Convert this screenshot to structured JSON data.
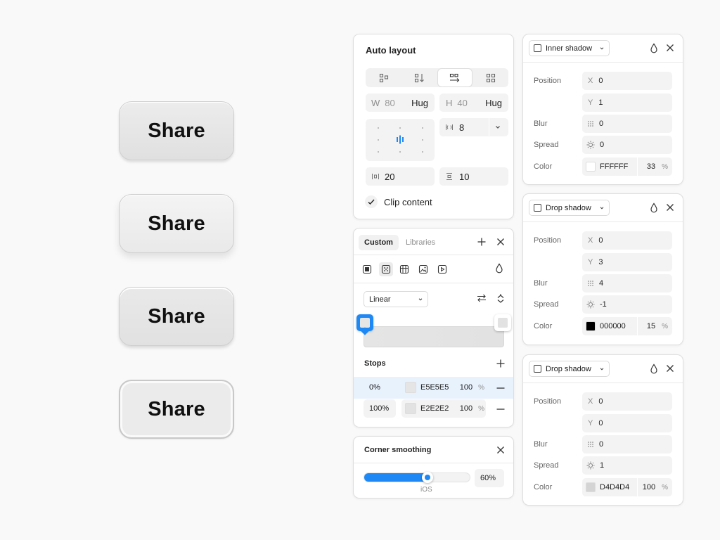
{
  "buttons": [
    {
      "label": "Share"
    },
    {
      "label": "Share"
    },
    {
      "label": "Share"
    },
    {
      "label": "Share"
    }
  ],
  "auto_layout": {
    "title": "Auto layout",
    "width_label": "W",
    "width_value": "80",
    "width_mode": "Hug",
    "height_label": "H",
    "height_value": "40",
    "height_mode": "Hug",
    "gap_value": "8",
    "padding_h": "20",
    "padding_v": "10",
    "clip_label": "Clip content"
  },
  "fill": {
    "tab_custom": "Custom",
    "tab_libraries": "Libraries",
    "gradient_type": "Linear",
    "stops_title": "Stops",
    "stops": [
      {
        "position": "0%",
        "hex": "E5E5E5",
        "opacity": "100",
        "unit": "%",
        "swatch": "#e5e5e5"
      },
      {
        "position": "100%",
        "hex": "E2E2E2",
        "opacity": "100",
        "unit": "%",
        "swatch": "#e2e2e2"
      }
    ],
    "accent": "#1e88f5"
  },
  "corner": {
    "title": "Corner smoothing",
    "value": "60%",
    "fraction": 0.6,
    "caption": "iOS"
  },
  "effects": [
    {
      "type": "Inner shadow",
      "position_label": "Position",
      "x_label": "X",
      "x": "0",
      "y_label": "Y",
      "y": "1",
      "blur_label": "Blur",
      "blur": "0",
      "spread_label": "Spread",
      "spread": "0",
      "color_label": "Color",
      "hex": "FFFFFF",
      "opacity": "33",
      "unit": "%",
      "swatch": "#ffffff"
    },
    {
      "type": "Drop shadow",
      "position_label": "Position",
      "x_label": "X",
      "x": "0",
      "y_label": "Y",
      "y": "3",
      "blur_label": "Blur",
      "blur": "4",
      "spread_label": "Spread",
      "spread": "-1",
      "color_label": "Color",
      "hex": "000000",
      "opacity": "15",
      "unit": "%",
      "swatch": "#000000"
    },
    {
      "type": "Drop shadow",
      "position_label": "Position",
      "x_label": "X",
      "x": "0",
      "y_label": "Y",
      "y": "0",
      "blur_label": "Blur",
      "blur": "0",
      "spread_label": "Spread",
      "spread": "1",
      "color_label": "Color",
      "hex": "D4D4D4",
      "opacity": "100",
      "unit": "%",
      "swatch": "#d4d4d4"
    }
  ]
}
